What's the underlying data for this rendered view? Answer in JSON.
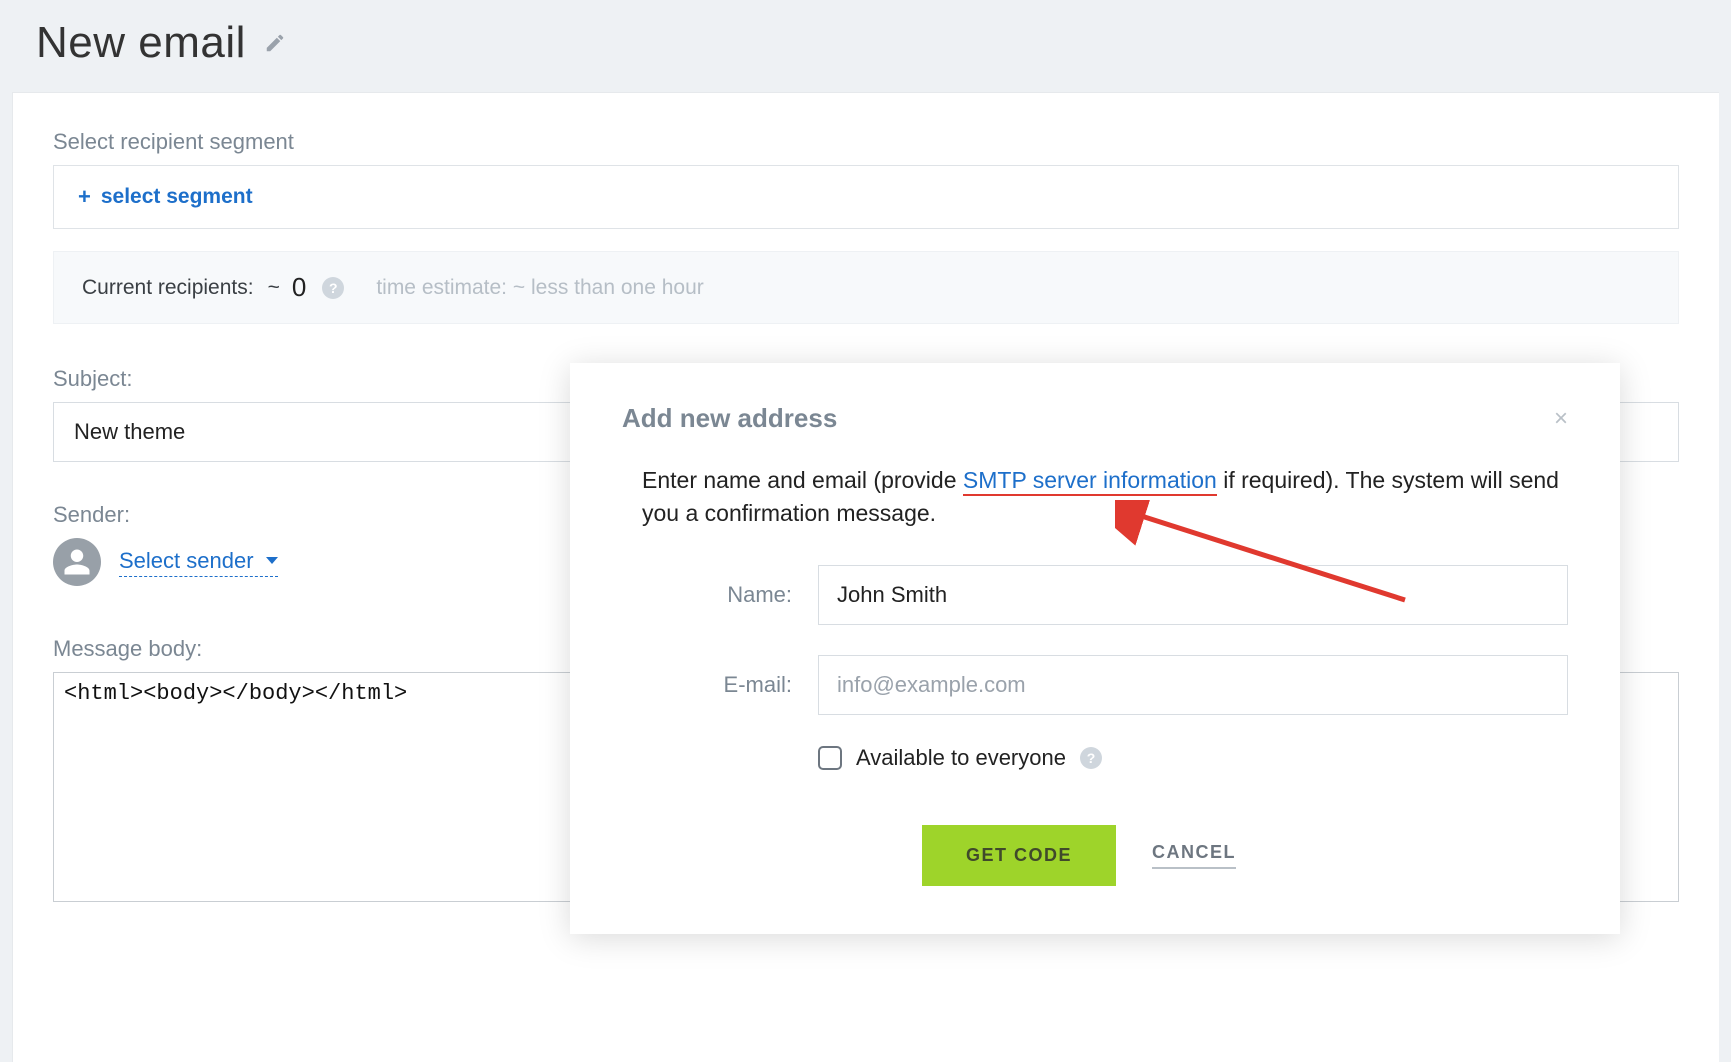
{
  "header": {
    "title": "New email"
  },
  "segment": {
    "label": "Select recipient segment",
    "link_text": "select segment",
    "plus": "+"
  },
  "recipients": {
    "label": "Current recipients:",
    "tilde": "~",
    "count": "0",
    "help": "?",
    "time_label": "time estimate:",
    "time_tilde": "~",
    "time_value": "less than one hour"
  },
  "subject": {
    "label": "Subject:",
    "value": "New theme"
  },
  "sender": {
    "label": "Sender:",
    "link_text": "Select sender"
  },
  "body": {
    "label": "Message body:",
    "content": "<html><body></body></html>"
  },
  "modal": {
    "title": "Add new address",
    "close": "×",
    "desc_pre": "Enter name and email (provide ",
    "smtp_link": "SMTP server information",
    "desc_post": " if required). The system will send you a confirmation message.",
    "name_label": "Name:",
    "name_value": "John Smith",
    "email_label": "E-mail:",
    "email_placeholder": "info@example.com",
    "available_label": "Available to everyone",
    "help": "?",
    "get_code": "GET CODE",
    "cancel": "CANCEL"
  }
}
